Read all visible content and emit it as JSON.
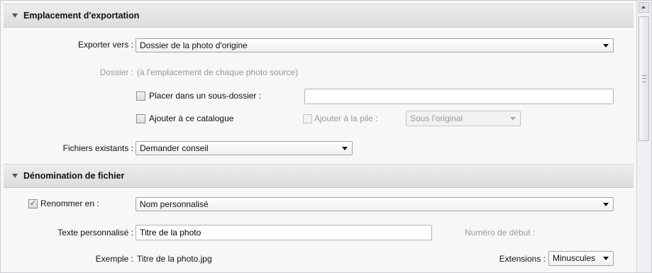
{
  "export_location": {
    "header": "Emplacement d'exportation",
    "export_to_label": "Exporter vers :",
    "export_to_value": "Dossier de la photo d'origine",
    "folder_label": "Dossier :",
    "folder_value": "(à l'emplacement de chaque photo source)",
    "subfolder_label": "Placer dans un sous-dossier :",
    "subfolder_value": "",
    "subfolder_checked": false,
    "add_catalog_label": "Ajouter à ce catalogue",
    "add_catalog_checked": false,
    "add_stack_label": "Ajouter à la pile :",
    "add_stack_checked": false,
    "stack_position_value": "Sous l'original",
    "existing_files_label": "Fichiers existants :",
    "existing_files_value": "Demander conseil"
  },
  "file_naming": {
    "header": "Dénomination de fichier",
    "rename_label": "Renommer en :",
    "rename_checked": true,
    "rename_template_value": "Nom personnalisé",
    "custom_text_label": "Texte personnalisé :",
    "custom_text_value": "Titre de la photo",
    "start_number_label": "Numéro de début :",
    "example_label": "Exemple :",
    "example_value": "Titre de la photo.jpg",
    "extensions_label": "Extensions :",
    "extensions_value": "Minuscules"
  },
  "icons": {
    "collapse": "triangle-down-icon",
    "check": "✓",
    "scroll_up": "chevron-up-icon"
  },
  "colors": {
    "header_bg": "#e2e2e2",
    "panel_bg": "#f6f6f6",
    "check_blue": "#2a4fa8"
  }
}
